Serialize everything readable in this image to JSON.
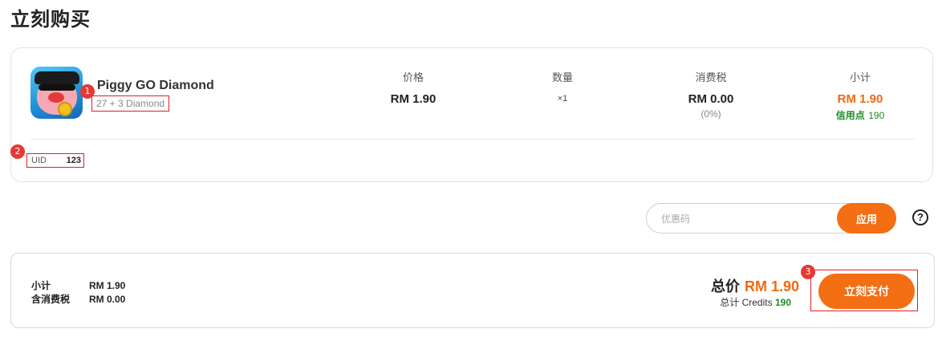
{
  "page": {
    "title": "立刻购买"
  },
  "product": {
    "name": "Piggy GO Diamond",
    "variant": "27 + 3 Diamond",
    "badge": "1",
    "icon": "piggy-go-game-icon"
  },
  "columns": {
    "price": {
      "label": "价格",
      "value": "RM 1.90"
    },
    "quantity": {
      "label": "数量",
      "value": "×1"
    },
    "tax": {
      "label": "消费税",
      "value": "RM 0.00",
      "note": "(0%)"
    },
    "subtotal": {
      "label": "小计",
      "value": "RM 1.90",
      "credits_label": "信用点",
      "credits_value": "190"
    }
  },
  "uid": {
    "label": "UID",
    "value": "123",
    "badge": "2"
  },
  "promo": {
    "placeholder": "优惠码",
    "apply_label": "应用",
    "help_icon": "?"
  },
  "summary": {
    "subtotal_label": "小计",
    "subtotal_value": "RM 1.90",
    "tax_label": "含消费税",
    "tax_value": "RM 0.00",
    "total_label": "总价",
    "total_value": "RM 1.90",
    "credits_label": "总计 Credits",
    "credits_value": "190",
    "pay_label": "立刻支付",
    "badge": "3"
  },
  "colors": {
    "accent": "#f46e14",
    "credit_green": "#1f8a2a",
    "badge_red": "#e53935"
  }
}
